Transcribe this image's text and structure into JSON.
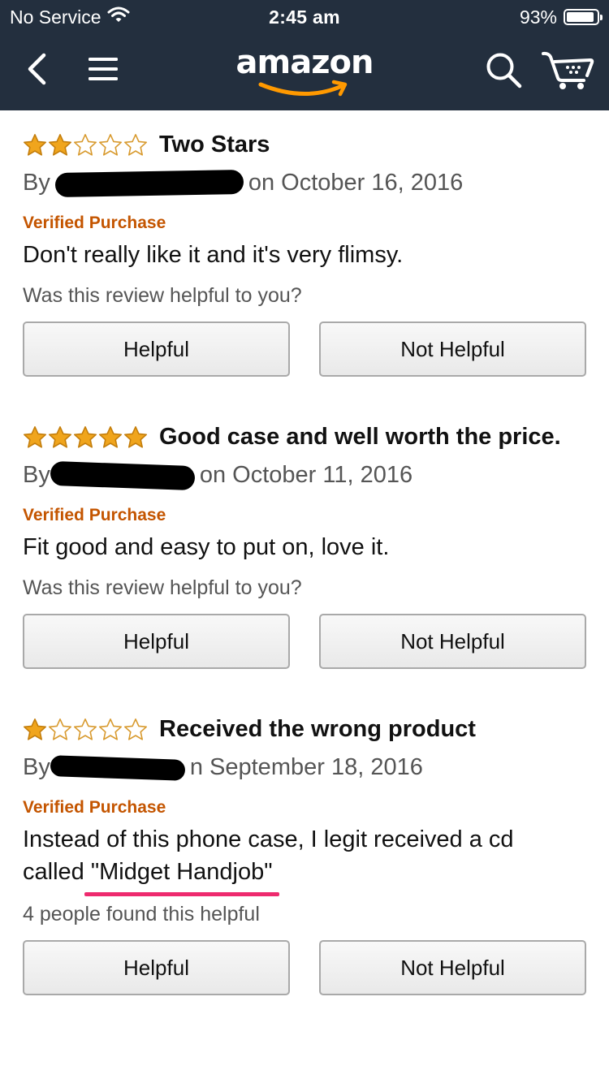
{
  "status_bar": {
    "carrier": "No Service",
    "time": "2:45 am",
    "battery": "93%",
    "battery_level": 0.93
  },
  "nav": {
    "logo_text": "amazon",
    "icons": [
      "back-chevron-icon",
      "menu-icon",
      "search-icon",
      "cart-icon"
    ]
  },
  "colors": {
    "header_bg": "#232f3e",
    "star": "#f0a51d",
    "verified": "#c45500",
    "annotation": "#ee2a6e"
  },
  "reviews": [
    {
      "rating": 2,
      "title": "Two Stars",
      "by": "By",
      "date": "on October 16, 2016",
      "verified": "Verified Purchase",
      "text": "Don't really like it and it's very flimsy.",
      "helpful_prompt": "Was this review helpful to you?",
      "helpful_button": "Helpful",
      "not_helpful_button": "Not Helpful"
    },
    {
      "rating": 5,
      "title": "Good case and well worth the price.",
      "by": "By",
      "date": "on October 11, 2016",
      "verified": "Verified Purchase",
      "text": "Fit good and easy to put on, love it.",
      "helpful_prompt": "Was this review helpful to you?",
      "helpful_button": "Helpful",
      "not_helpful_button": "Not Helpful"
    },
    {
      "rating": 1,
      "title": "Received the wrong product",
      "by": "By",
      "date": "n September 18, 2016",
      "verified": "Verified Purchase",
      "text_line1": "Instead of this phone case, I legit received a cd",
      "text_line2_prefix": "called ",
      "text_line2_quote": "\"Midget Handjob\"",
      "helpful_prompt": "4 people found this helpful",
      "helpful_button": "Helpful",
      "not_helpful_button": "Not Helpful"
    }
  ]
}
